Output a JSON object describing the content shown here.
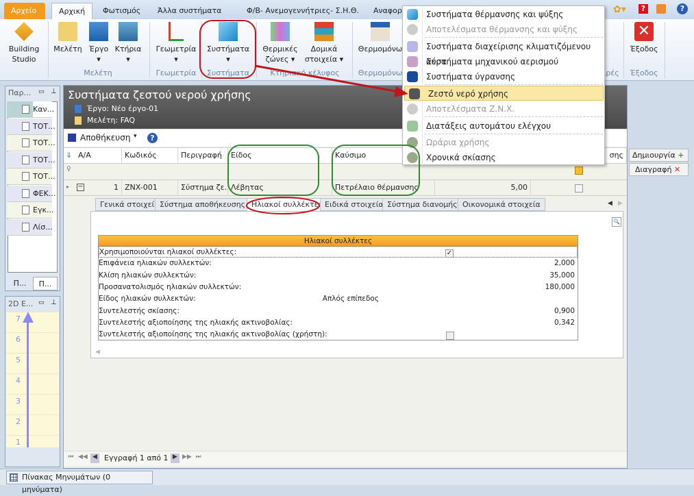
{
  "tabs": [
    {
      "label": "Αρχείο"
    },
    {
      "label": "Αρχική"
    },
    {
      "label": "Φωτισμός"
    },
    {
      "label": "Άλλα συστήματα"
    },
    {
      "label": "Φ/Β- Ανεμογεννήτριες- Σ.Η.Θ."
    },
    {
      "label": "Αναφορ"
    }
  ],
  "ribbon": {
    "buttons": [
      {
        "label": "Building Studio"
      },
      {
        "label": "Μελέτη"
      },
      {
        "label": "Έργο"
      },
      {
        "label": "Κτήρια"
      },
      {
        "label": "Γεωμετρία"
      },
      {
        "label": "Συστήματα"
      },
      {
        "label": "Θερμικές ζώνες"
      },
      {
        "label": "Δομικά στοιχεία"
      },
      {
        "label": "Θερμομόνω"
      },
      {
        "label": "Έξοδος"
      }
    ],
    "groups": [
      {
        "label": "Μελέτη"
      },
      {
        "label": "Γεωμετρία"
      },
      {
        "label": "Συστήματα"
      },
      {
        "label": "Κτηριακό κέλυφος"
      },
      {
        "label": "Θερμομόνω"
      },
      {
        "label": "ρές"
      },
      {
        "label": "Έξοδος"
      }
    ]
  },
  "menu": {
    "items": [
      {
        "label": "Συστήματα θέρμανσης και ψύξης",
        "icon": "cube-icon",
        "disabled": false
      },
      {
        "label": "Αποτελέσματα θέρμανσης και ψύξης",
        "icon": "chart-icon",
        "disabled": true
      },
      {
        "label": "Συστήματα διαχείρισης κλιματιζόμενου αέρα",
        "icon": "fan-icon",
        "disabled": false
      },
      {
        "label": "Συστήματα μηχανικού αερισμού",
        "icon": "air-icon",
        "disabled": false
      },
      {
        "label": "Συστήματα ύγρανσης",
        "icon": "drops-icon",
        "disabled": false
      },
      {
        "label": "Ζεστό νερό χρήσης",
        "icon": "valve-icon",
        "disabled": false,
        "selected": true
      },
      {
        "label": "Αποτελέσματα Ζ.Ν.Χ.",
        "icon": "chart-icon",
        "disabled": true
      },
      {
        "label": "Διατάξεις αυτομάτου ελέγχου",
        "icon": "bms-icon",
        "disabled": false
      },
      {
        "label": "Ωράρια χρήσης",
        "icon": "clock-icon",
        "disabled": true
      },
      {
        "label": "Χρονικά σκίασης",
        "icon": "clock-icon",
        "disabled": false
      }
    ]
  },
  "left_panel": {
    "title": "Παρ...",
    "items": [
      "Καν...",
      "ΤΟΤ...",
      "ΤΟΤ...",
      "ΤΟΤ...",
      "ΤΟΤ...",
      "ΦΕΚ...",
      "Εγκ...",
      "Λίσ..."
    ],
    "tabs": [
      "Π...",
      "Π..."
    ]
  },
  "panel2": {
    "title": "2D Ε...",
    "ticks": [
      "7",
      "6",
      "5",
      "4",
      "3",
      "2",
      "1"
    ]
  },
  "main": {
    "title": "Συστήματα ζεστού νερού χρήσης",
    "project": "Έργο: Νέο έργο-01",
    "study": "Μελέτη: FAQ",
    "save_label": "Αποθήκευση",
    "columns": [
      "A/A",
      "Κωδικός",
      "Περιγραφή",
      "Είδος",
      "Καύσιμο",
      "",
      "σης"
    ],
    "row": {
      "aa": "1",
      "code": "ZNX-001",
      "desc": "Σύστημα ζε...",
      "type": "Λέβητας",
      "fuel": "Πετρέλαιο θέρμανσης",
      "value": "5,00"
    },
    "detail_tabs": [
      "Γενικά στοιχεία",
      "Σύστημα αποθήκευσης",
      "Ηλιακοί συλλέκτες",
      "Ειδικά στοιχεία",
      "Σύστημα διανομής",
      "Οικονομικά στοιχεία"
    ],
    "active_detail_tab": "Ηλιακοί συλλέκτες",
    "props_title": "Ηλιακοί συλλέκτες",
    "props": [
      {
        "label": "Χρησιμοποιούνται ηλιακοί συλλέκτες:",
        "value": "",
        "checked": true
      },
      {
        "label": "Επιφάνεια ηλιακών συλλεκτών:",
        "value": "2,000"
      },
      {
        "label": "Κλίση ηλιακών συλλεκτών:",
        "value": "35,000"
      },
      {
        "label": "Προσανατολισμός ηλιακών συλλεκτών:",
        "value": "180,000"
      },
      {
        "label": "Είδος ηλιακών συλλεκτών:",
        "value": "Απλός επίπεδος",
        "center": true
      },
      {
        "label": "Συντελεστής σκίασης:",
        "value": "0,900"
      },
      {
        "label": "Συντελεστής αξιοποίησης της ηλιακής ακτινοβολίας:",
        "value": "0,342"
      },
      {
        "label": "Συντελεστής αξιοποίησης της ηλιακής ακτινοβολίας (χρήστη):",
        "value": "",
        "checked": false
      }
    ],
    "nav_label": "Εγγραφή 1 από 1"
  },
  "side_buttons": {
    "create": "Δημιουργία",
    "delete": "Διαγραφή"
  },
  "status": {
    "messages": "Πίνακας Μηνυμάτων (0 μηνύματα)"
  },
  "colors": {
    "file_tab": "#f29b1d",
    "header_dark": "#5a5a5a",
    "prop_header": "#f6a81c",
    "annotation_red": "#c0151b",
    "annotation_green": "#2e8b2e",
    "menu_highlight": "#fbe8a6"
  }
}
